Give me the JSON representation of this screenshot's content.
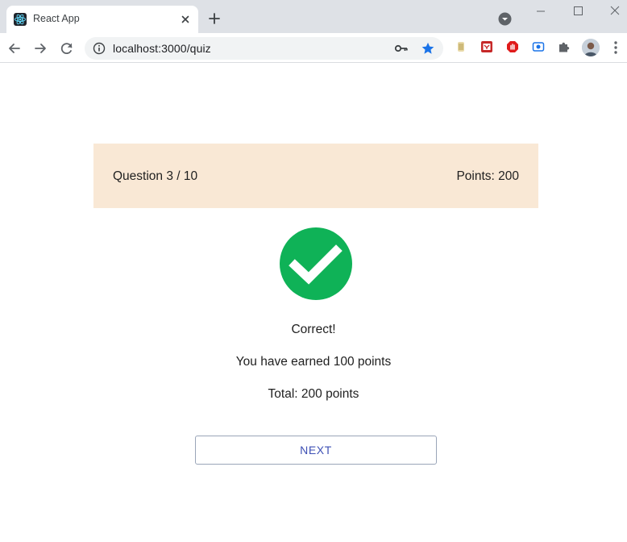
{
  "browser": {
    "tab_title": "React App",
    "url": "localhost:3000/quiz",
    "icons": [
      "react-favicon",
      "close-icon",
      "plus-icon",
      "tab-search-icon",
      "minimize-icon",
      "maximize-icon",
      "window-close-icon",
      "back-arrow-icon",
      "forward-arrow-icon",
      "reload-icon",
      "info-icon",
      "key-icon",
      "star-icon",
      "extensions-puzzle-icon",
      "kebab-menu-icon"
    ],
    "star_color": "#1a73e8"
  },
  "quiz": {
    "question_label": "Question 3 / 10",
    "points_label": "Points: 200",
    "result_message": "Correct!",
    "earned_message": "You have earned 100 points",
    "total_message": "Total: 200 points",
    "next_label": "NEXT",
    "header_color": "#f9e8d5",
    "success_color": "#0fb257",
    "button_text_color": "#3f51b5"
  }
}
